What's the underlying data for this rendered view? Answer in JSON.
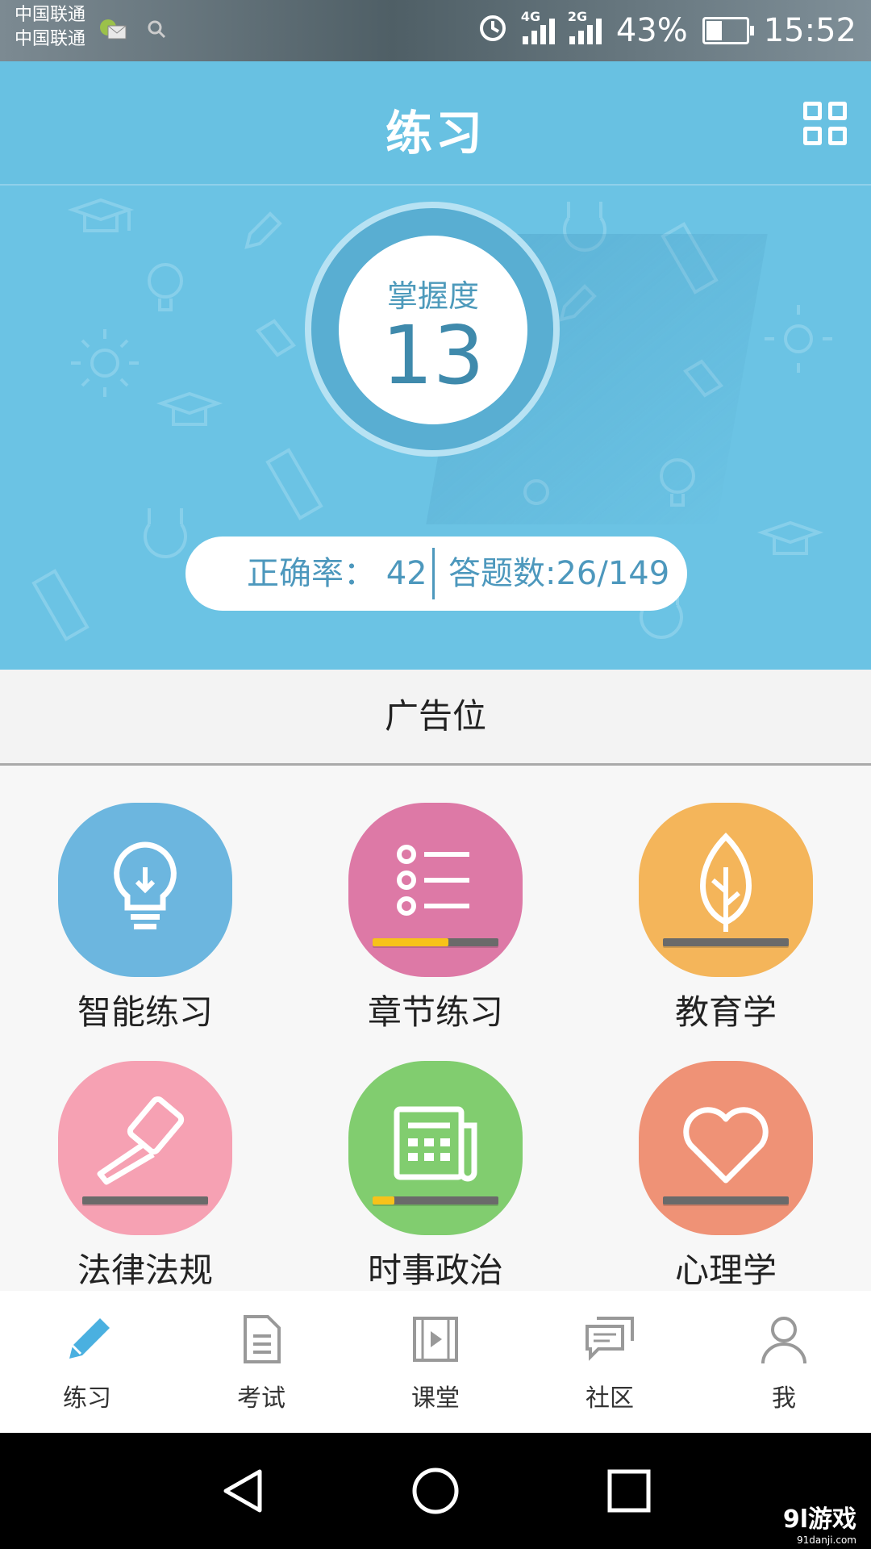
{
  "status_bar": {
    "carrier_1": "中国联通",
    "carrier_2": "中国联通",
    "net_1": "4G",
    "net_2": "2G",
    "battery_percent": "43%",
    "battery_level": 0.43,
    "time": "15:52"
  },
  "header": {
    "title": "练习"
  },
  "mastery": {
    "label": "掌握度",
    "value": "13"
  },
  "stats": {
    "accuracy": "正确率： 42",
    "answered": "答题数:26/149"
  },
  "ad": {
    "label": "广告位"
  },
  "categories": [
    {
      "label": "智能练习",
      "color": "#6cb6df",
      "icon": "lightbulb-icon",
      "progress": null
    },
    {
      "label": "章节练习",
      "color": "#dd79a6",
      "icon": "list-icon",
      "progress": 0.6
    },
    {
      "label": "教育学",
      "color": "#f4b55a",
      "icon": "leaf-icon",
      "progress": 0
    },
    {
      "label": "法律法规",
      "color": "#f6a1b3",
      "icon": "gavel-icon",
      "progress": 0
    },
    {
      "label": "时事政治",
      "color": "#81cd6f",
      "icon": "newspaper-icon",
      "progress": 0.17
    },
    {
      "label": "心理学",
      "color": "#ef9276",
      "icon": "heart-icon",
      "progress": 0
    }
  ],
  "bottom_nav": [
    {
      "label": "练习",
      "icon": "pencil-icon",
      "active": true
    },
    {
      "label": "考试",
      "icon": "document-icon",
      "active": false
    },
    {
      "label": "课堂",
      "icon": "film-icon",
      "active": false
    },
    {
      "label": "社区",
      "icon": "chat-icon",
      "active": false
    },
    {
      "label": "我",
      "icon": "user-icon",
      "active": false
    }
  ],
  "watermark": {
    "brand": "9l游戏",
    "url": "91danji.com"
  },
  "colors": {
    "header_bg": "#68c1e2",
    "accent": "#4d98bd",
    "active_nav": "#4ab0e0",
    "progress_fill": "#f7c21a"
  }
}
